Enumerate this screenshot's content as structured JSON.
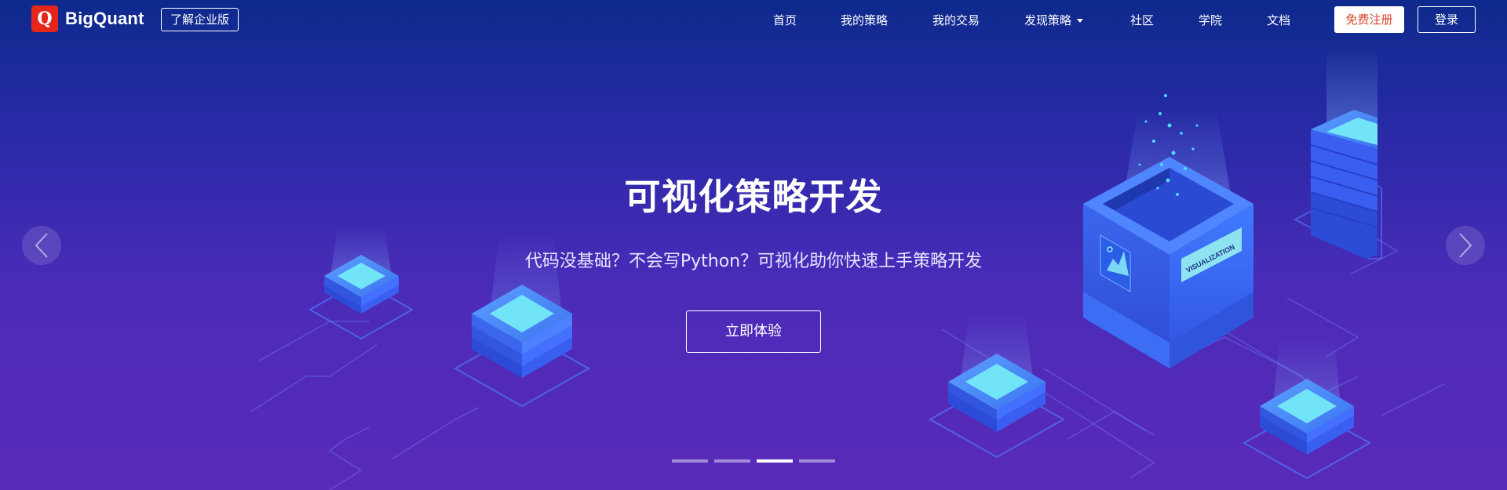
{
  "brand": {
    "name": "BigQuant",
    "mark": "Q"
  },
  "header": {
    "enterprise_label": "了解企业版",
    "nav": [
      {
        "label": "首页"
      },
      {
        "label": "我的策略"
      },
      {
        "label": "我的交易"
      },
      {
        "label": "发现策略",
        "has_dropdown": true
      },
      {
        "label": "社区"
      },
      {
        "label": "学院"
      },
      {
        "label": "文档"
      }
    ],
    "register_label": "免费注册",
    "login_label": "登录"
  },
  "hero": {
    "title": "可视化策略开发",
    "subtitle": "代码没基础？不会写Python？可视化助你快速上手策略开发",
    "cta_label": "立即体验",
    "badge_text": "VISUALIZATION"
  },
  "carousel": {
    "slide_count": 4,
    "active_index": 2
  },
  "icons": {
    "prev": "chevron-left-icon",
    "next": "chevron-right-icon",
    "dropdown": "caret-down-icon"
  },
  "colors": {
    "brand_red": "#e5271b",
    "bg_top": "#0d2a8c",
    "bg_bottom": "#5a2ab8",
    "cube_blue": "#3c6cf5",
    "cyan": "#6fe2f5"
  }
}
